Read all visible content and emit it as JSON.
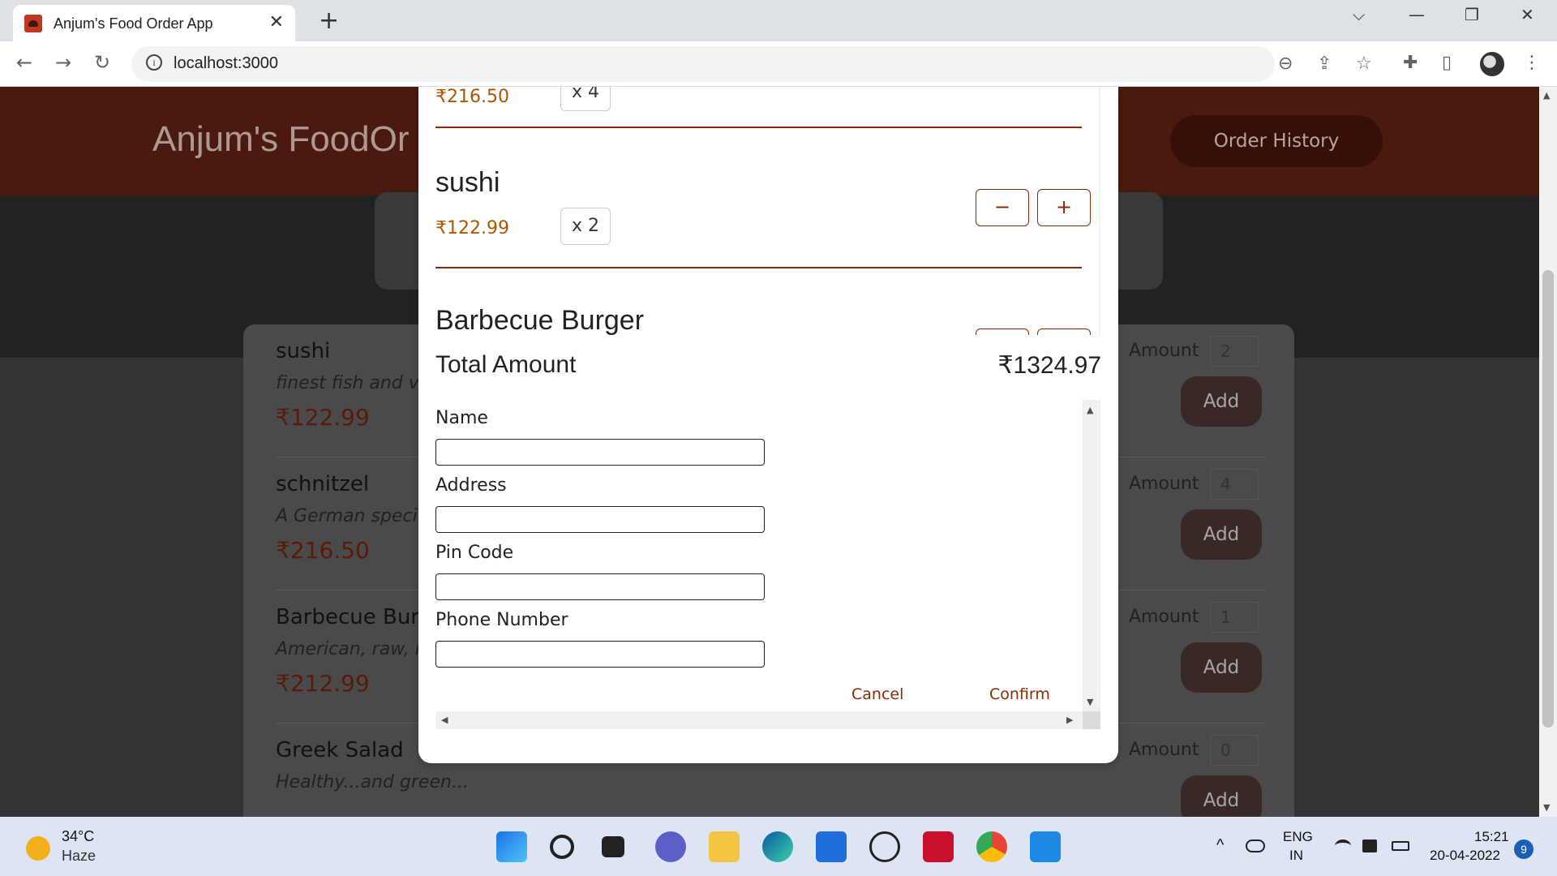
{
  "browser": {
    "tab_title": "Anjum's Food Order App",
    "tab_close": "✕",
    "new_tab": "+",
    "url": "localhost:3000",
    "info_glyph": "i",
    "window_controls": [
      "⌵",
      "—",
      "❐",
      "✕"
    ],
    "nav": {
      "back": "←",
      "forward": "→",
      "reload": "↻"
    },
    "icons": [
      "zoom-out-icon",
      "share-icon",
      "star-icon",
      "extensions-icon",
      "side-panel-icon",
      "profile-avatar",
      "menu-icon"
    ],
    "glyphs": {
      "zoom": "⊖",
      "share": "⇪",
      "star": "☆",
      "ext": "✚",
      "side": "▯",
      "menu": "⋮"
    }
  },
  "app": {
    "title": "Anjum's FoodOr",
    "order_history": "Order History"
  },
  "meals": [
    {
      "name": "sushi",
      "desc": "finest fish and ve",
      "price": "₹122.99",
      "amount_label": "Amount",
      "amount": "2",
      "add": "Add"
    },
    {
      "name": "schnitzel",
      "desc": "A German speci",
      "price": "₹216.50",
      "amount_label": "Amount",
      "amount": "4",
      "add": "Add"
    },
    {
      "name": "Barbecue Burg",
      "desc": "American, raw, m",
      "price": "₹212.99",
      "amount_label": "Amount",
      "amount": "1",
      "add": "Add"
    },
    {
      "name": "Greek Salad",
      "desc": "Healthy...and green...",
      "price": "",
      "amount_label": "Amount",
      "amount": "0",
      "add": "Add"
    }
  ],
  "cart": {
    "items": [
      {
        "name": "",
        "price": "₹216.50",
        "qty": "x 4"
      },
      {
        "name": "sushi",
        "price": "₹122.99",
        "qty": "x 2",
        "minus": "−",
        "plus": "+"
      },
      {
        "name": "Barbecue Burger",
        "price": "",
        "qty": "",
        "minus": "",
        "plus": ""
      }
    ],
    "scroll_up": "▲",
    "scroll_down": "▼",
    "total_label": "Total Amount",
    "total_value": "₹1324.97"
  },
  "checkout": {
    "fields": [
      {
        "label": "Name",
        "value": ""
      },
      {
        "label": "Address",
        "value": ""
      },
      {
        "label": "Pin Code",
        "value": ""
      },
      {
        "label": "Phone Number",
        "value": ""
      }
    ],
    "cancel": "Cancel",
    "confirm": "Confirm",
    "scroll_glyphs": {
      "up": "▲",
      "down": "▼",
      "left": "◀",
      "right": "▶"
    }
  },
  "page_scroll": {
    "up": "▲",
    "down": "▼"
  },
  "taskbar": {
    "weather_temp": "34°C",
    "weather_desc": "Haze",
    "apps": [
      "windows-start-icon",
      "search-icon",
      "task-view-icon",
      "chat-icon",
      "file-explorer-icon",
      "edge-icon",
      "store-icon",
      "dell-icon",
      "mcafee-icon",
      "chrome-icon",
      "vscode-icon"
    ],
    "tray_chevron": "^",
    "language": "ENG",
    "region": "IN",
    "time": "15:21",
    "date": "20-04-2022",
    "notifications": "9"
  }
}
